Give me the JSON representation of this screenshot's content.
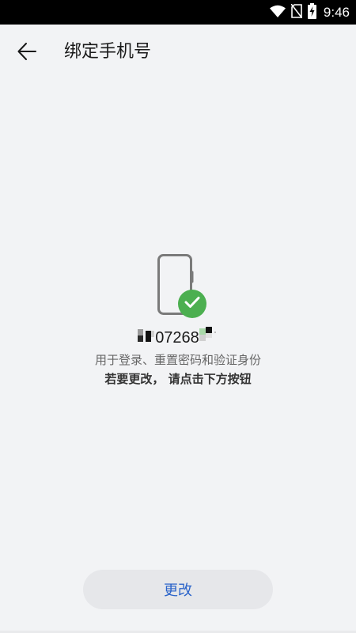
{
  "status_bar": {
    "time": "9:46",
    "icons": [
      "wifi-icon",
      "no-sim-icon",
      "battery-charging-icon"
    ]
  },
  "header": {
    "back_icon": "arrow-left-icon",
    "title": "绑定手机号"
  },
  "main": {
    "illustration_icon": "phone-icon",
    "badge_icon": "check-icon",
    "phone_number_visible": "07268",
    "description_line1": "用于登录、重置密码和验证身份",
    "description_line2": "若要更改， 请点击下方按钮"
  },
  "footer": {
    "change_label": "更改"
  },
  "colors": {
    "background": "#f2f3f5",
    "accent_blue": "#2a63c9",
    "success_green": "#4caf50",
    "button_bg": "#e6e7ea"
  }
}
